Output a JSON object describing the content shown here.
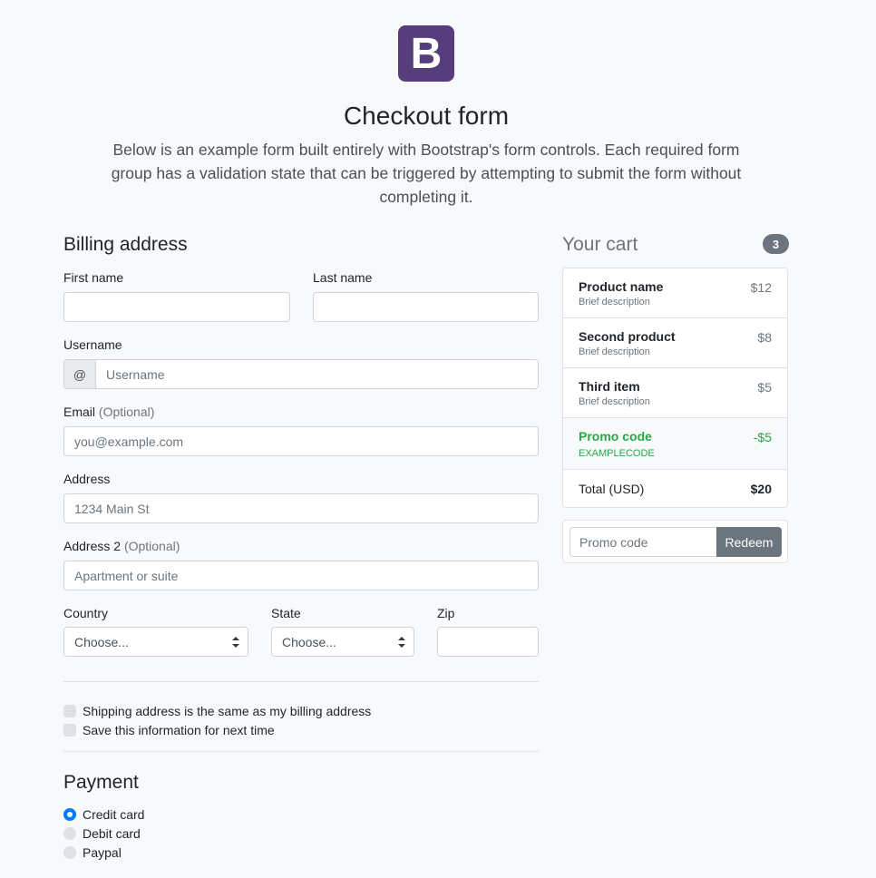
{
  "header": {
    "logo_letter": "B",
    "title": "Checkout form",
    "lead": "Below is an example form built entirely with Bootstrap's form controls. Each required form group has a validation state that can be triggered by attempting to submit the form without completing it."
  },
  "billing": {
    "heading": "Billing address",
    "first_name_label": "First name",
    "last_name_label": "Last name",
    "username_label": "Username",
    "username_prepend": "@",
    "username_placeholder": "Username",
    "email_label": "Email",
    "email_optional": "(Optional)",
    "email_placeholder": "you@example.com",
    "address_label": "Address",
    "address_placeholder": "1234 Main St",
    "address2_label": "Address 2",
    "address2_optional": "(Optional)",
    "address2_placeholder": "Apartment or suite",
    "country_label": "Country",
    "country_value": "Choose...",
    "state_label": "State",
    "state_value": "Choose...",
    "zip_label": "Zip",
    "same_address_label": "Shipping address is the same as my billing address",
    "save_info_label": "Save this information for next time"
  },
  "payment": {
    "heading": "Payment",
    "options": [
      "Credit card",
      "Debit card",
      "Paypal"
    ],
    "selected": "Credit card"
  },
  "cart": {
    "title": "Your cart",
    "count": "3",
    "items": [
      {
        "name": "Product name",
        "desc": "Brief description",
        "price": "$12"
      },
      {
        "name": "Second product",
        "desc": "Brief description",
        "price": "$8"
      },
      {
        "name": "Third item",
        "desc": "Brief description",
        "price": "$5"
      }
    ],
    "promo": {
      "name": "Promo code",
      "code": "EXAMPLECODE",
      "amount": "-$5"
    },
    "total_label": "Total (USD)",
    "total_value": "$20",
    "promo_placeholder": "Promo code",
    "redeem_label": "Redeem"
  },
  "colors": {
    "brand": "#563d7c",
    "primary": "#007bff",
    "success": "#28a745",
    "secondary": "#6c757d"
  }
}
